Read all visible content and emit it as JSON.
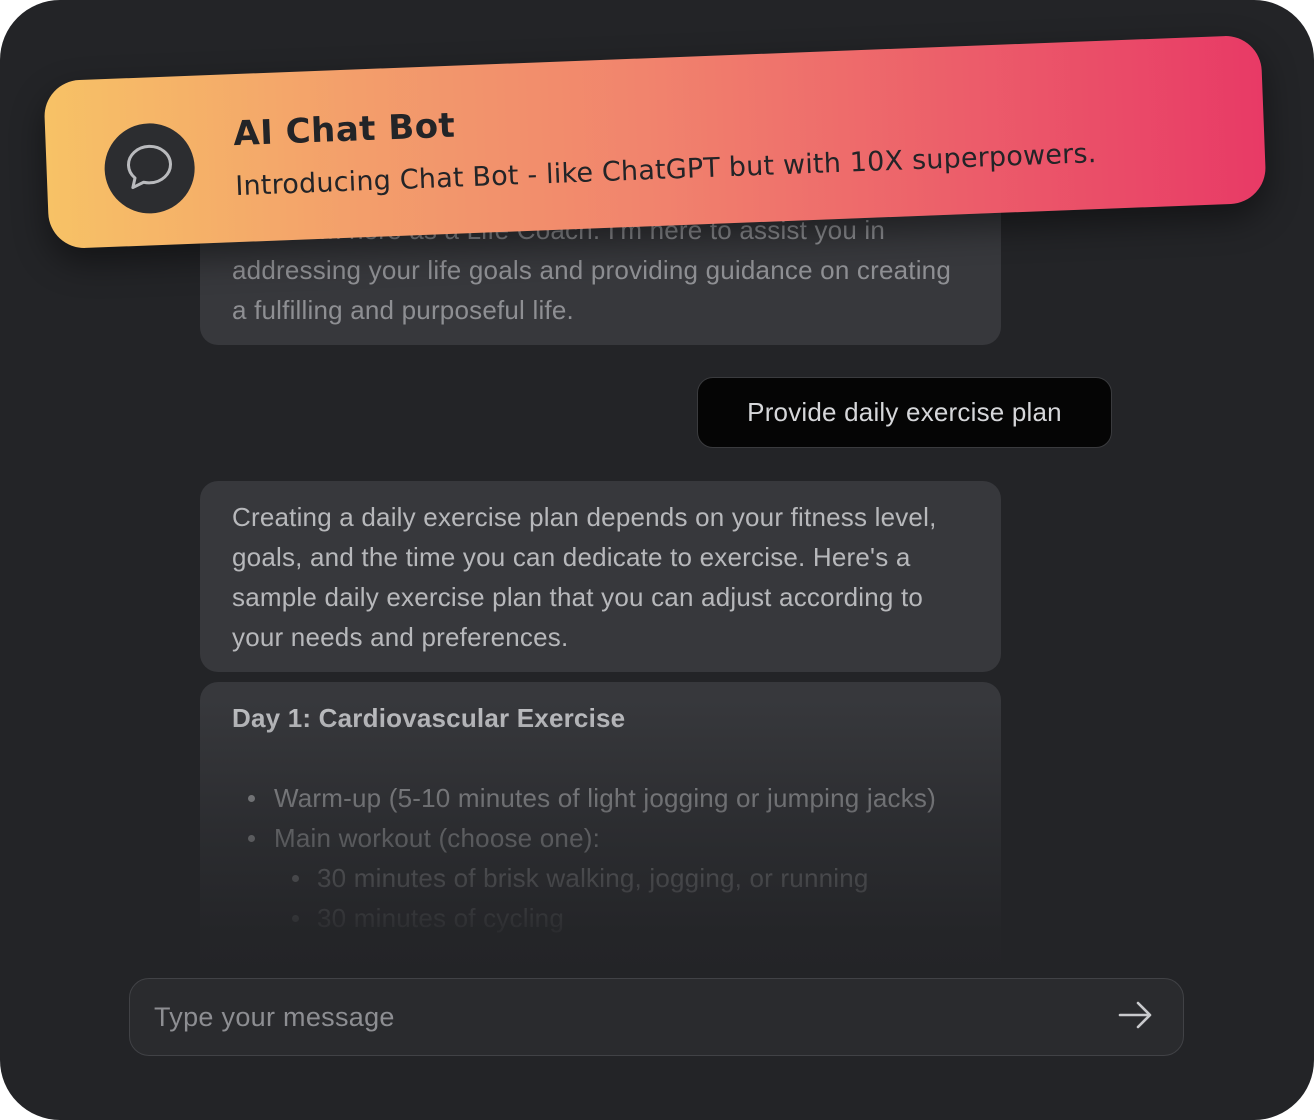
{
  "banner": {
    "title": "AI Chat Bot",
    "subtitle": "Introducing Chat Bot - like ChatGPT but with 10X superpowers.",
    "icon": "chat-bubble-icon"
  },
  "messages": {
    "intro": "Hello! I'm here as a Life Coach. I'm here to assist you in addressing your life goals and providing guidance on creating a fulfilling and purposeful life.",
    "user": "Provide daily exercise plan",
    "response": "Creating a daily exercise plan depends on your fitness level, goals, and the time you can dedicate to exercise. Here's a sample daily exercise plan that you can adjust according to your needs and preferences.",
    "plan": {
      "heading": "Day 1: Cardiovascular Exercise",
      "items": [
        "Warm-up (5-10 minutes of light jogging or jumping jacks)",
        "Main workout (choose one):"
      ],
      "subitems": [
        "30 minutes of brisk walking, jogging, or running",
        "30 minutes of cycling"
      ]
    }
  },
  "composer": {
    "placeholder": "Type your message",
    "send_icon": "arrow-right-icon"
  },
  "colors": {
    "background": "#232427",
    "bot_bubble": "#37383c",
    "user_bubble": "#050505",
    "banner_gradient_start": "#f7c266",
    "banner_gradient_end": "#e83a66"
  }
}
